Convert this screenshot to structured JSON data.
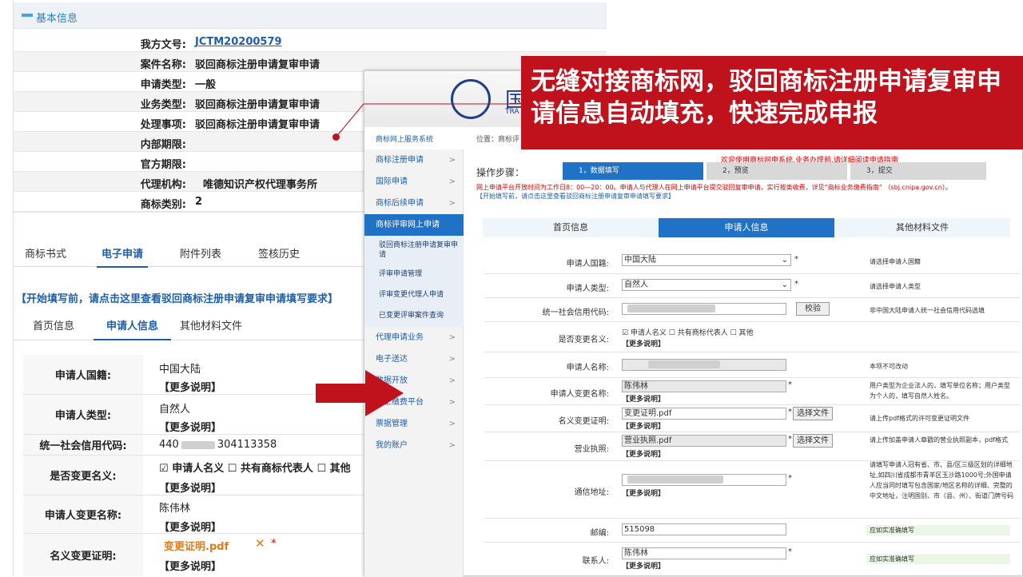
{
  "basic": {
    "title": "基本信息",
    "rows": [
      {
        "k": "我方文号:",
        "v": "JCTM20200579"
      },
      {
        "k": "案件名称:",
        "v": "驳回商标注册申请复审申请"
      },
      {
        "k": "申请类型:",
        "v": "一般"
      },
      {
        "k": "业务类型:",
        "v": "驳回商标注册申请复审申请"
      },
      {
        "k": "处理事项:",
        "v": "驳回商标注册申请复审申请"
      },
      {
        "k": "内部期限:",
        "v": ""
      },
      {
        "k": "官方期限:",
        "v": ""
      },
      {
        "k": "代理机构:",
        "v": "唯德知识产权代理事务所"
      },
      {
        "k": "商标类别:",
        "v": "2"
      }
    ]
  },
  "tabs1": [
    "商标书式",
    "电子申请",
    "附件列表",
    "签核历史"
  ],
  "tip": "【开始填写前，请点击这里查看驳回商标注册申请复审申请填写要求】",
  "tabs2": [
    "首页信息",
    "申请人信息",
    "其他材料文件"
  ],
  "form": {
    "nationality": {
      "k": "申请人国籍:",
      "v": "中国大陆"
    },
    "type": {
      "k": "申请人类型:",
      "v": "自然人"
    },
    "credit": {
      "k": "统一社会信用代码:",
      "v1": "440",
      "v2": "304113358"
    },
    "change": {
      "k": "是否变更名义:",
      "o1": "申请人名义",
      "o2": "共有商标代表人",
      "o3": "其他"
    },
    "newname": {
      "k": "申请人变更名称:",
      "v": "陈伟林"
    },
    "cert": {
      "k": "名义变更证明:",
      "v": "变更证明.pdf",
      "x": "✕",
      "star": "*"
    },
    "more": "【更多说明】"
  },
  "overlay": {
    "logo": "国",
    "logo_sub": "TRA",
    "sys": "商标网上服务系统",
    "crumb": "位置：商标评",
    "menu": [
      {
        "label": "商标注册申请",
        "ch": ">"
      },
      {
        "label": "国际申请",
        "ch": ">"
      },
      {
        "label": "商标后续申请",
        "ch": ">"
      },
      {
        "label": "商标评审网上申请",
        "ch": ""
      },
      {
        "label": "代理申请业务",
        "ch": ">"
      },
      {
        "label": "电子送达",
        "ch": ">"
      },
      {
        "label": "数据开放",
        "ch": ">"
      },
      {
        "label": "网上缴费平台",
        "ch": ">"
      },
      {
        "label": "票据管理",
        "ch": ">"
      },
      {
        "label": "我的账户",
        "ch": ">"
      }
    ],
    "submenu": [
      "驳回商标注册申请复审申请",
      "评审申请管理",
      "评审变更代理人申请",
      "已变更评审案件查询"
    ],
    "steps_label": "操作步骤：",
    "steps": [
      "1，数据填写",
      "2，预览",
      "3，提交"
    ],
    "welcome": "欢迎使用商标网申系统,业务办理前,请详细阅读申请指南",
    "rednote": "网上申请平台开放时间为工作日8：00—20：00。申请人与代理人在网上申请平台提交驳回复审申请，实行按类收费，详见“商标业务缴费指南” （sbj.cnipa.gov.cn）。",
    "bluenote": "【开始填写前，请点击这里查看驳回商标注册申请复审申请填写要求】",
    "tabs": [
      "首页信息",
      "申请人信息",
      "其他材料文件"
    ],
    "rows": {
      "nat": {
        "k": "申请人国籍:",
        "v": "中国大陆",
        "n": "请选择申请人国籍"
      },
      "type": {
        "k": "申请人类型:",
        "v": "自然人",
        "n": "请选择申请人类型"
      },
      "credit": {
        "k": "统一社会信用代码:",
        "btn": "校验",
        "n": "非中国大陆申请人统一社会信用代码选填"
      },
      "change": {
        "k": "是否变更名义:",
        "v": "☑ 申请人名义 ☐ 共有商标代表人 ☐ 其他"
      },
      "name": {
        "k": "申请人名称:",
        "n": "本项不可改动"
      },
      "newname": {
        "k": "申请人变更名称:",
        "v": "陈伟林",
        "n": "用户类型为企业法人的，填写单位名称；用户类型为个人的，填写自然人姓名。"
      },
      "cert": {
        "k": "名义变更证明:",
        "v": "变更证明.pdf",
        "btn": "选择文件",
        "n": "请上传pdf格式的许可变更证明文件"
      },
      "lic": {
        "k": "营业执照:",
        "v": "营业执照.pdf",
        "btn": "选择文件",
        "n": "请上传加盖申请人章戳的营业执照副本，pdf格式"
      },
      "addr": {
        "k": "通信地址:",
        "n": "请填写申请人冠有省、市、县/区三级区划的详细地址,如四川省成都市青羊区玉沙路1000号;外国申请人应当同时填写包含国家/地区名称的详细、完整的中文地址，注明国别、市（县、州）、街道门牌号码"
      },
      "zip": {
        "k": "邮编:",
        "v": "515098",
        "n": "应如实准确填写"
      },
      "contact": {
        "k": "联系人:",
        "v": "陈伟林",
        "n": "应如实准确填写"
      }
    },
    "more": "【更多说明】"
  },
  "callout": "无缝对接商标网，驳回商标注册申请复审申请信息自动填充，快速完成申报"
}
